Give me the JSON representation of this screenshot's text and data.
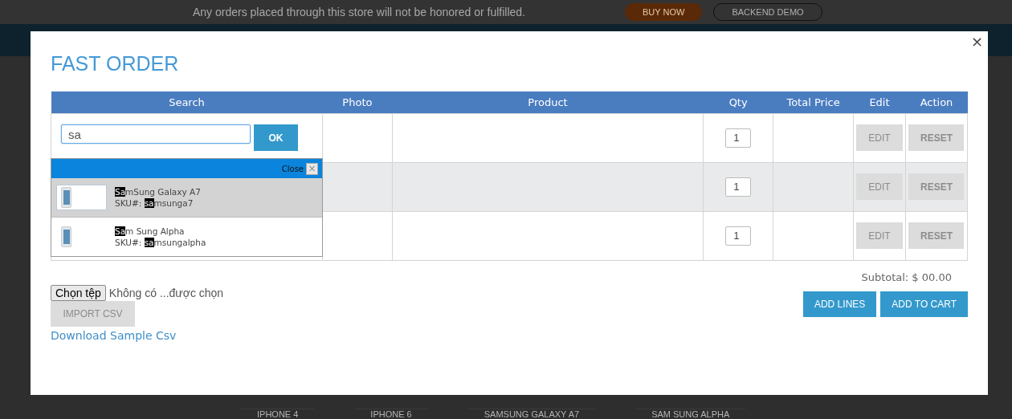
{
  "background_page": {
    "notice": "Any orders placed through this store will not be honored or fulfilled.",
    "buttons": [
      {
        "label": "BUY NOW",
        "kind": "primary"
      },
      {
        "label": "BACKEND DEMO",
        "kind": "outline"
      }
    ],
    "products": [
      "IPHONE 4",
      "IPHONE 6",
      "SAMSUNG GALAXY A7",
      "SAM SUNG ALPHA"
    ]
  },
  "modal": {
    "title": "FAST ORDER",
    "close": "×",
    "table": {
      "columns": [
        "Search",
        "Photo",
        "Product",
        "Qty",
        "Total Price",
        "Edit",
        "Action"
      ],
      "rows": [
        {
          "search": {
            "value": "sa",
            "button": "OK"
          },
          "qty": "1",
          "edit": {
            "label": "EDIT",
            "disabled": true
          },
          "reset": {
            "label": "RESET",
            "disabled": true
          }
        },
        {
          "qty": "1",
          "edit": {
            "label": "EDIT",
            "disabled": true
          },
          "reset": {
            "label": "RESET",
            "disabled": true
          }
        },
        {
          "qty": "1",
          "edit": {
            "label": "EDIT",
            "disabled": true
          },
          "reset": {
            "label": "RESET",
            "disabled": true
          }
        }
      ]
    },
    "suggestions": {
      "close_label": "Close",
      "close_icon": "×",
      "items": [
        {
          "name": "**Sa**mSung Galaxy A7",
          "sku": "SKU#: **sa**msunga7",
          "selected": true
        },
        {
          "name": "**Sa**m Sung Alpha",
          "sku": "SKU#: **sa**msungalpha",
          "selected": false
        }
      ]
    },
    "file_button": "Chọn tệp",
    "file_status": "Không có ...được chọn",
    "import": {
      "label": "IMPORT CSV",
      "disabled": true
    },
    "download_link": "Download Sample Csv",
    "subtotal": "Subtotal: $ 00.00",
    "actions": [
      "ADD LINES",
      "ADD TO CART"
    ]
  }
}
